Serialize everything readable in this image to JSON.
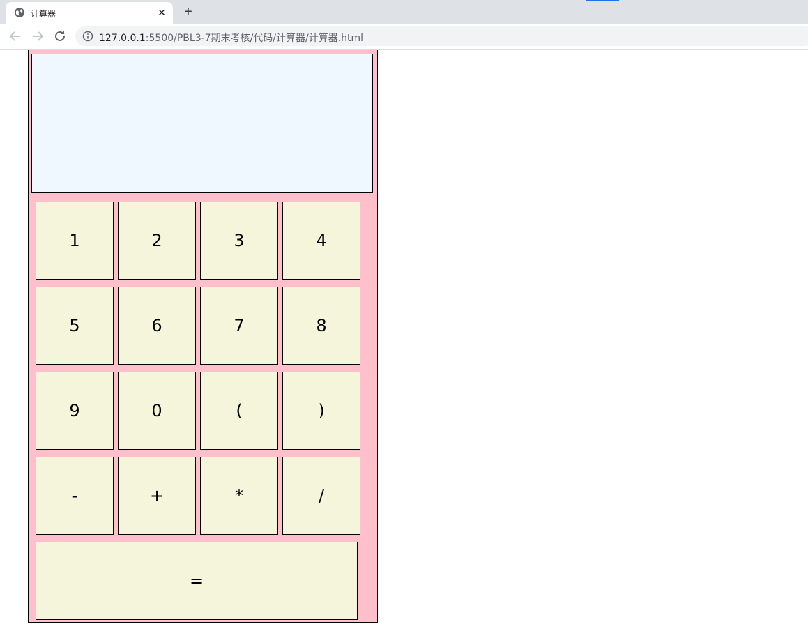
{
  "browser": {
    "tab_title": "计算器",
    "tab_close": "✕",
    "new_tab": "+",
    "url_host": "127.0.0.1",
    "url_rest": ":5500/PBL3-7期末考核/代码/计算器/计算器.html"
  },
  "calculator": {
    "display_value": "",
    "keys": [
      "1",
      "2",
      "3",
      "4",
      "5",
      "6",
      "7",
      "8",
      "9",
      "0",
      "(",
      ")",
      "-",
      "+",
      "*",
      "/"
    ],
    "equals": "="
  }
}
